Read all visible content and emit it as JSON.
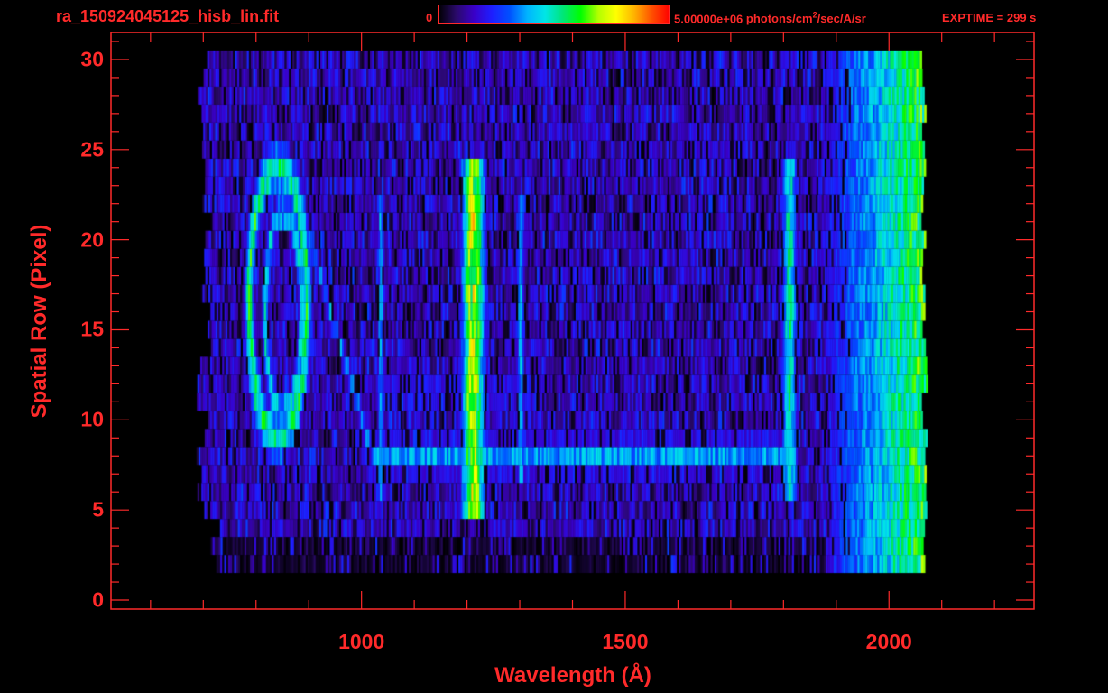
{
  "header": {
    "filename": "ra_150924045125_hisb_lin.fit",
    "colorbar_min": "0",
    "colorbar_max": "5.00000e+06",
    "colorbar_units_prefix": " photons/cm",
    "colorbar_units_sup": "2",
    "colorbar_units_suffix": "/sec/A/sr",
    "exptime": "EXPTIME = 299 s"
  },
  "colors": {
    "text": "#ff2a2a",
    "axis": "#ff2a2a",
    "background": "#000000",
    "colormap": [
      "#000000",
      "#2a0a6a",
      "#3a00c8",
      "#1e1eff",
      "#0050ff",
      "#00b4ff",
      "#00e6e6",
      "#00e678",
      "#00ff00",
      "#b4ff00",
      "#ffff00",
      "#ffb400",
      "#ff5000",
      "#ff0000"
    ]
  },
  "chart_data": {
    "type": "heatmap",
    "title": "ra_150924045125_hisb_lin.fit",
    "xlabel": "Wavelength (Å)",
    "ylabel": "Spatial Row (Pixel)",
    "xlim": [
      525,
      2275
    ],
    "ylim": [
      -0.5,
      31.5
    ],
    "xticks": [
      1000,
      1500,
      2000
    ],
    "xtick_labels": [
      "1000",
      "1500",
      "2000"
    ],
    "yticks": [
      0,
      5,
      10,
      15,
      20,
      25,
      30
    ],
    "ytick_labels": [
      "0",
      "5",
      "10",
      "15",
      "20",
      "25",
      "30"
    ],
    "data_x_range": [
      700,
      2070
    ],
    "data_y_range": [
      2,
      30
    ],
    "colorbar_range": [
      0,
      5000000
    ],
    "colorbar_units": "photons/cm2/sec/A/sr",
    "exptime_s": 299,
    "grid": false,
    "features": [
      {
        "kind": "ring",
        "center_x": 840,
        "center_y": 16.5,
        "radius_x": 55,
        "radius_y": 7.5,
        "intensity": 0.55
      },
      {
        "kind": "ring",
        "center_x": 850,
        "center_y": 16,
        "radius_x": 35,
        "radius_y": 5.5,
        "intensity": 0.45
      },
      {
        "kind": "vertical_band",
        "x": 1210,
        "width_x": 45,
        "y_from": 5,
        "y_to": 24,
        "intensity": 0.72
      },
      {
        "kind": "vertical_band",
        "x": 1810,
        "width_x": 30,
        "y_from": 6,
        "y_to": 24,
        "intensity": 0.5
      },
      {
        "kind": "vertical_band",
        "x": 1035,
        "width_x": 12,
        "y_from": 6,
        "y_to": 22,
        "intensity": 0.38
      },
      {
        "kind": "vertical_band",
        "x": 1300,
        "width_x": 14,
        "y_from": 7,
        "y_to": 22,
        "intensity": 0.38
      },
      {
        "kind": "horizontal_band",
        "y": 8,
        "height_y": 1.2,
        "x_from": 1020,
        "x_to": 1800,
        "intensity": 0.38
      },
      {
        "kind": "horizontal_band",
        "y": 11.5,
        "height_y": 0.8,
        "x_from": 1030,
        "x_to": 1320,
        "intensity": 0.3
      },
      {
        "kind": "diagonal_band",
        "x_from": 880,
        "y_from": 22,
        "x_to": 1020,
        "y_to": 8,
        "width_x": 14,
        "intensity": 0.36
      },
      {
        "kind": "edge_gradient",
        "x_from": 1880,
        "x_to": 2070,
        "intensity_from": 0.2,
        "intensity_to": 0.62
      }
    ],
    "background_intensity": 0.14
  }
}
